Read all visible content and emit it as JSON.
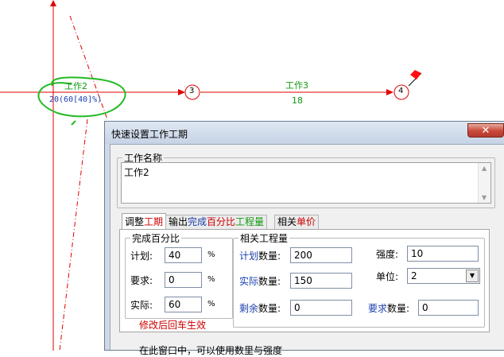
{
  "network": {
    "task2": {
      "name": "工作2",
      "duration_text": "20(60[40]%)"
    },
    "task3": {
      "name": "工作3",
      "duration": "18"
    },
    "node3": "3",
    "node4": "4"
  },
  "colors": {
    "arrow_red": "#e00000",
    "green_text": "#119911",
    "blue_text": "#1a3fb0",
    "annotation_green": "#22bb22",
    "red_text": "#cc0000"
  },
  "dialog": {
    "title": "快速设置工作工期",
    "close_label": "✕",
    "work_name_group": "工作名称",
    "work_name_value": "工作2",
    "tabs": [
      {
        "parts": [
          {
            "text": "调整",
            "color": "#000000"
          },
          {
            "text": "工期",
            "color": "#cc0000"
          }
        ]
      },
      {
        "parts": [
          {
            "text": "输出",
            "color": "#000000"
          },
          {
            "text": "完成",
            "color": "#1a3fb0"
          },
          {
            "text": "百分比",
            "color": "#cc0000"
          },
          {
            "text": "工程量",
            "color": "#119911"
          }
        ]
      },
      {
        "parts": [
          {
            "text": "相关",
            "color": "#000000"
          },
          {
            "text": "单价",
            "color": "#cc0000"
          }
        ]
      }
    ],
    "percent_group": {
      "title": "完成百分比",
      "plan_label": "计划:",
      "plan_value": "40",
      "required_label": "要求:",
      "required_value": "0",
      "actual_label": "实际:",
      "actual_value": "60",
      "pct_unit": "%",
      "hint": "修改后回车生效"
    },
    "quantity_group": {
      "title": "相关工程量",
      "plan_qty_label_a": "计划",
      "plan_qty_label_b": "数量:",
      "plan_qty_value": "200",
      "actual_qty_label_a": "实际",
      "actual_qty_label_b": "数量:",
      "actual_qty_value": "150",
      "remaining_qty_label_a": "剩余",
      "remaining_qty_label_b": "数量:",
      "remaining_qty_value": "0",
      "intensity_label": "强度:",
      "intensity_value": "10",
      "unit_label": "单位:",
      "unit_value": "2",
      "required_qty_label_a": "要求",
      "required_qty_label_b": "数量:",
      "required_qty_value": "0"
    },
    "bottom_note": "在此窗口中，可以使用数里与强度"
  }
}
